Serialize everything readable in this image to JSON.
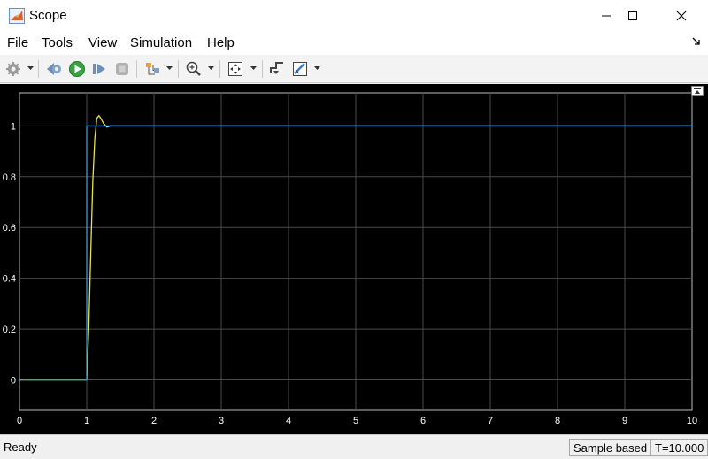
{
  "window": {
    "title": "Scope"
  },
  "menu": [
    "File",
    "Tools",
    "View",
    "Simulation",
    "Help"
  ],
  "toolbar": {
    "buttons": [
      "settings-icon",
      "step-back-icon",
      "run-icon",
      "step-forward-icon",
      "stop-icon",
      "highlight-icon",
      "zoom-icon",
      "fit-to-view-icon",
      "triggers-icon",
      "cursor-measurements-icon"
    ]
  },
  "status": {
    "ready": "Ready",
    "mode": "Sample based",
    "time": "T=10.000"
  },
  "chart_data": {
    "type": "line",
    "xlim": [
      0,
      10
    ],
    "ylim": [
      -0.12,
      1.13
    ],
    "xticks": [
      "0",
      "1",
      "2",
      "3",
      "4",
      "5",
      "6",
      "7",
      "8",
      "9",
      "10"
    ],
    "yticks": [
      "0",
      "0.2",
      "0.4",
      "0.6",
      "0.8",
      "1"
    ],
    "grid": true,
    "background": "#000000",
    "series": [
      {
        "color": "#e8e34a",
        "x": [
          0,
          1.0,
          1.03,
          1.06,
          1.09,
          1.12,
          1.15,
          1.18,
          1.21,
          1.25,
          1.3,
          1.35,
          1.4,
          10
        ],
        "y": [
          0,
          0,
          0.2,
          0.5,
          0.78,
          0.95,
          1.03,
          1.04,
          1.03,
          1.01,
          0.995,
          1.0,
          1.0,
          1.0
        ]
      },
      {
        "color": "#2f9fe6",
        "x": [
          0,
          1.0,
          1.0,
          10
        ],
        "y": [
          0,
          0,
          1,
          1
        ]
      }
    ]
  }
}
